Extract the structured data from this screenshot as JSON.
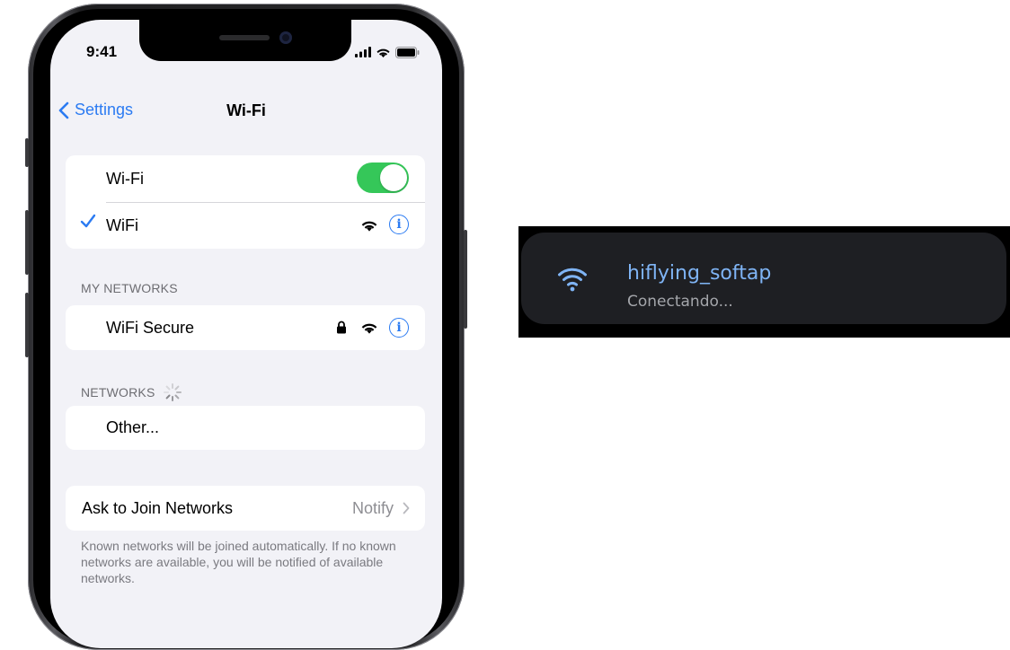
{
  "status_bar": {
    "time": "9:41"
  },
  "nav": {
    "back_label": "Settings",
    "title": "Wi-Fi"
  },
  "wifi_group": {
    "toggle_label": "Wi-Fi",
    "toggle_on": true,
    "connected_network": "WiFi"
  },
  "my_networks": {
    "header": "MY NETWORKS",
    "items": [
      {
        "name": "WiFi Secure",
        "locked": true
      }
    ]
  },
  "networks": {
    "header": "NETWORKS",
    "other_label": "Other..."
  },
  "ask_to_join": {
    "label": "Ask to Join Networks",
    "value": "Notify",
    "footnote": "Known networks will be joined automatically. If no known networks are available, you will be notified of available networks."
  },
  "android_notification": {
    "network_name": "hiflying_softap",
    "status": "Conectando..."
  },
  "colors": {
    "ios_accent": "#2b7bf2",
    "toggle_on": "#35c759",
    "android_accent": "#7fb4f5"
  },
  "icons": [
    "chevron-left-icon",
    "checkmark-icon",
    "wifi-icon",
    "info-icon",
    "lock-icon",
    "spinner-icon",
    "chevron-right-icon",
    "signal-icon",
    "battery-icon"
  ]
}
